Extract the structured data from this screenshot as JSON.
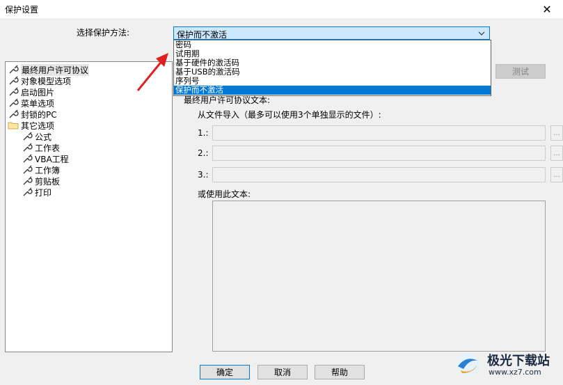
{
  "window": {
    "title": "保护设置"
  },
  "protection": {
    "label": "选择保护方法:",
    "selected": "保护而不激活",
    "options": [
      "密码",
      "试用期",
      "基于硬件的激活码",
      "基于USB的激活码",
      "序列号",
      "保护而不激活"
    ]
  },
  "tree": [
    {
      "label": "最终用户许可协议",
      "icon": "wrench-icon",
      "selected": true
    },
    {
      "label": "对象模型选项",
      "icon": "wrench-icon"
    },
    {
      "label": "启动图片",
      "icon": "wrench-icon"
    },
    {
      "label": "菜单选项",
      "icon": "wrench-icon"
    },
    {
      "label": "封锁的PC",
      "icon": "wrench-icon"
    },
    {
      "label": "其它选项",
      "icon": "folder-icon"
    },
    {
      "label": "公式",
      "icon": "wrench-icon"
    },
    {
      "label": "工作表",
      "icon": "wrench-icon"
    },
    {
      "label": "VBA工程",
      "icon": "wrench-icon"
    },
    {
      "label": "工作簿",
      "icon": "wrench-icon"
    },
    {
      "label": "剪贴板",
      "icon": "wrench-icon"
    },
    {
      "label": "打印",
      "icon": "wrench-icon"
    }
  ],
  "eula": {
    "section_label": "最终用户许可协议文本:",
    "import_label": "从文件导入（最多可以使用3个单独显示的文件）:",
    "file1_label": "1.:",
    "file2_label": "2.:",
    "file3_label": "3.:",
    "browse_label": "...",
    "text_label": "或使用此文本:",
    "test_button": "测试"
  },
  "footer": {
    "ok": "确定",
    "cancel": "取消",
    "help": "帮助"
  },
  "watermark": {
    "name": "极光下载站",
    "url": "www.xz7.com"
  },
  "colors": {
    "accent": "#0078d7",
    "arrow": "#e02020"
  }
}
